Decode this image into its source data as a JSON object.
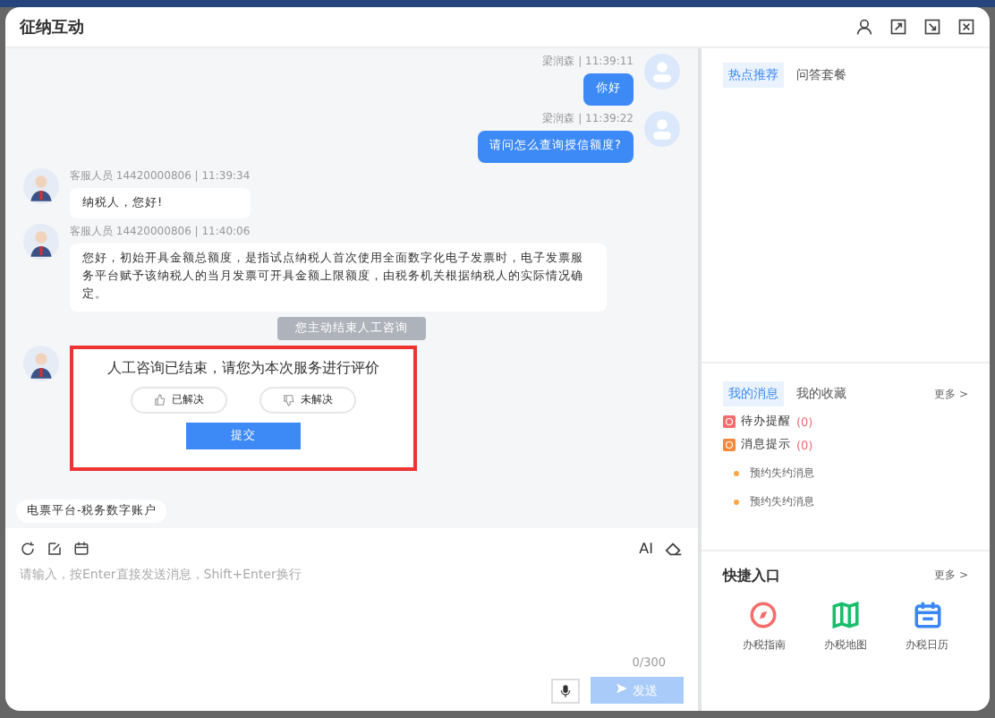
{
  "window": {
    "title": "征纳互动"
  },
  "messages": [
    {
      "kind": "outgoing",
      "meta": "梁润森 | 11:39:11",
      "text": "你好"
    },
    {
      "kind": "outgoing",
      "meta": "梁润森 | 11:39:22",
      "text": "请问怎么查询授信额度?"
    },
    {
      "kind": "incoming",
      "meta": "客服人员 14420000806 | 11:39:34",
      "text": "纳税人，您好!"
    },
    {
      "kind": "incoming",
      "meta": "客服人员 14420000806 | 11:40:06",
      "text": "您好，初始开具金额总额度，是指试点纳税人首次使用全面数字化电子发票时，电子发票服务平台赋予该纳税人的当月发票可开具金额上限额度，由税务机关根据纳税人的实际情况确定。"
    },
    {
      "kind": "notice",
      "text": "您主动结束人工咨询"
    },
    {
      "kind": "rating",
      "title": "人工咨询已结束，请您为本次服务进行评价",
      "options": [
        {
          "label": "已解决",
          "selected": false
        },
        {
          "label": "未解决",
          "selected": false
        }
      ],
      "submit": "提交"
    }
  ],
  "source_tag": "电票平台-税务数字账户",
  "input": {
    "placeholder": "请输入，按Enter直接发送消息，Shift+Enter换行",
    "counter": "0/300",
    "ai_label": "AI",
    "send": "发送"
  },
  "hot_tabs": [
    {
      "label": "热点推荐",
      "selected": true
    },
    {
      "label": "问答套餐",
      "selected": false
    }
  ],
  "message_tabs": [
    {
      "label": "我的消息",
      "selected": true
    },
    {
      "label": "我的收藏",
      "selected": false
    }
  ],
  "message_more": "更多 >",
  "notifications": [
    {
      "label": "待办提醒",
      "count": "(0)",
      "color": "#f56c6c"
    },
    {
      "label": "消息提示",
      "count": "(0)",
      "color": "#f7893b"
    }
  ],
  "appointments": [
    "预约失约消息",
    "预约失约消息"
  ],
  "shortcuts": {
    "title": "快捷入口",
    "more": "更多 >",
    "items": [
      {
        "kind": "compass",
        "label": "办税指南",
        "color": "#f56c6c"
      },
      {
        "kind": "map",
        "label": "办税地图",
        "color": "#19be6b"
      },
      {
        "kind": "calendar",
        "label": "办税日历",
        "color": "#3a86f5"
      }
    ]
  }
}
